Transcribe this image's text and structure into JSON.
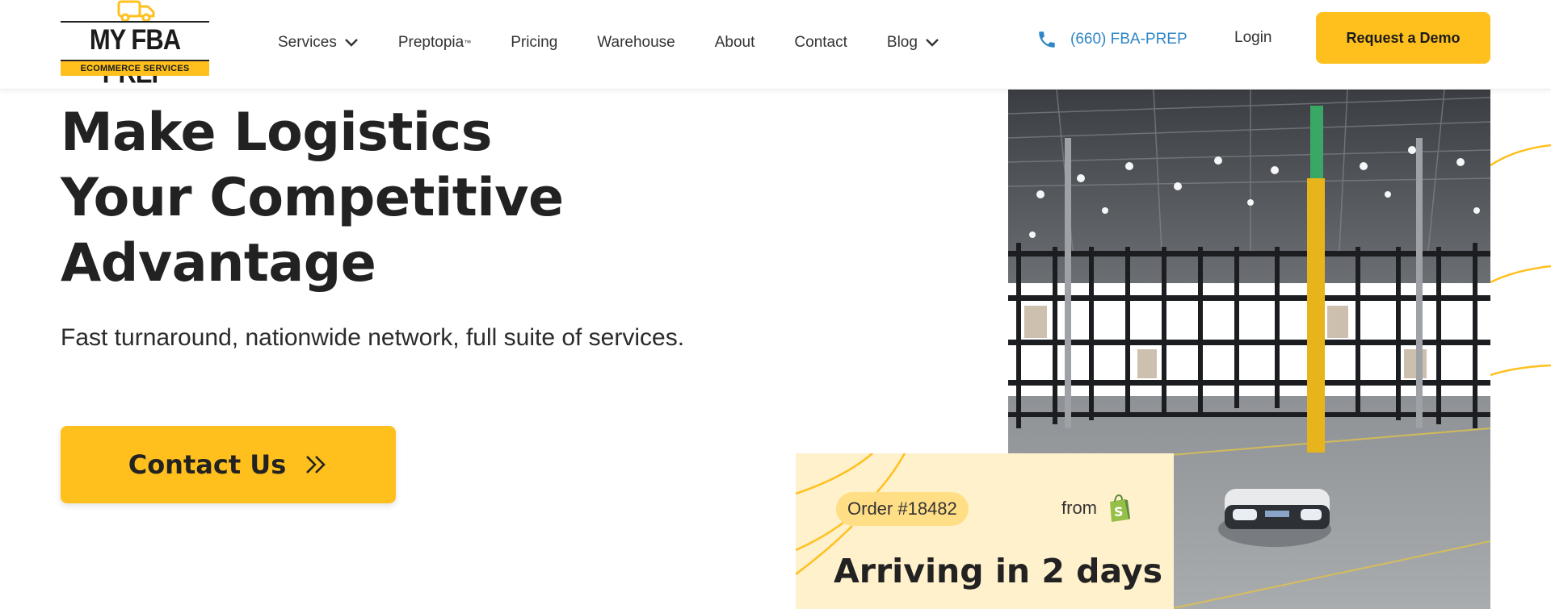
{
  "brand": {
    "name": "MY FBA PREP",
    "tagline": "ECOMMERCE SERVICES",
    "accent": "#ffc01e"
  },
  "nav": {
    "items": [
      {
        "label": "Services",
        "dropdown": true
      },
      {
        "label": "Preptopia",
        "mark": "™",
        "dropdown": false
      },
      {
        "label": "Pricing",
        "dropdown": false
      },
      {
        "label": "Warehouse",
        "dropdown": false
      },
      {
        "label": "About",
        "dropdown": false
      },
      {
        "label": "Contact",
        "dropdown": false
      },
      {
        "label": "Blog",
        "dropdown": true
      }
    ],
    "phone": "(660) FBA-PREP",
    "phone_color": "#2f86c6",
    "login": "Login",
    "demo": "Request a Demo"
  },
  "hero": {
    "title_lines": [
      "Make Logistics",
      "Your Competitive",
      "Advantage"
    ],
    "subtitle": "Fast turnaround, nationwide network, full suite of services.",
    "cta": "Contact Us"
  },
  "order_card": {
    "order": "Order #18482",
    "from": "from",
    "from_icon": "shopify-bag-icon",
    "eta": "Arriving in 2 days"
  }
}
